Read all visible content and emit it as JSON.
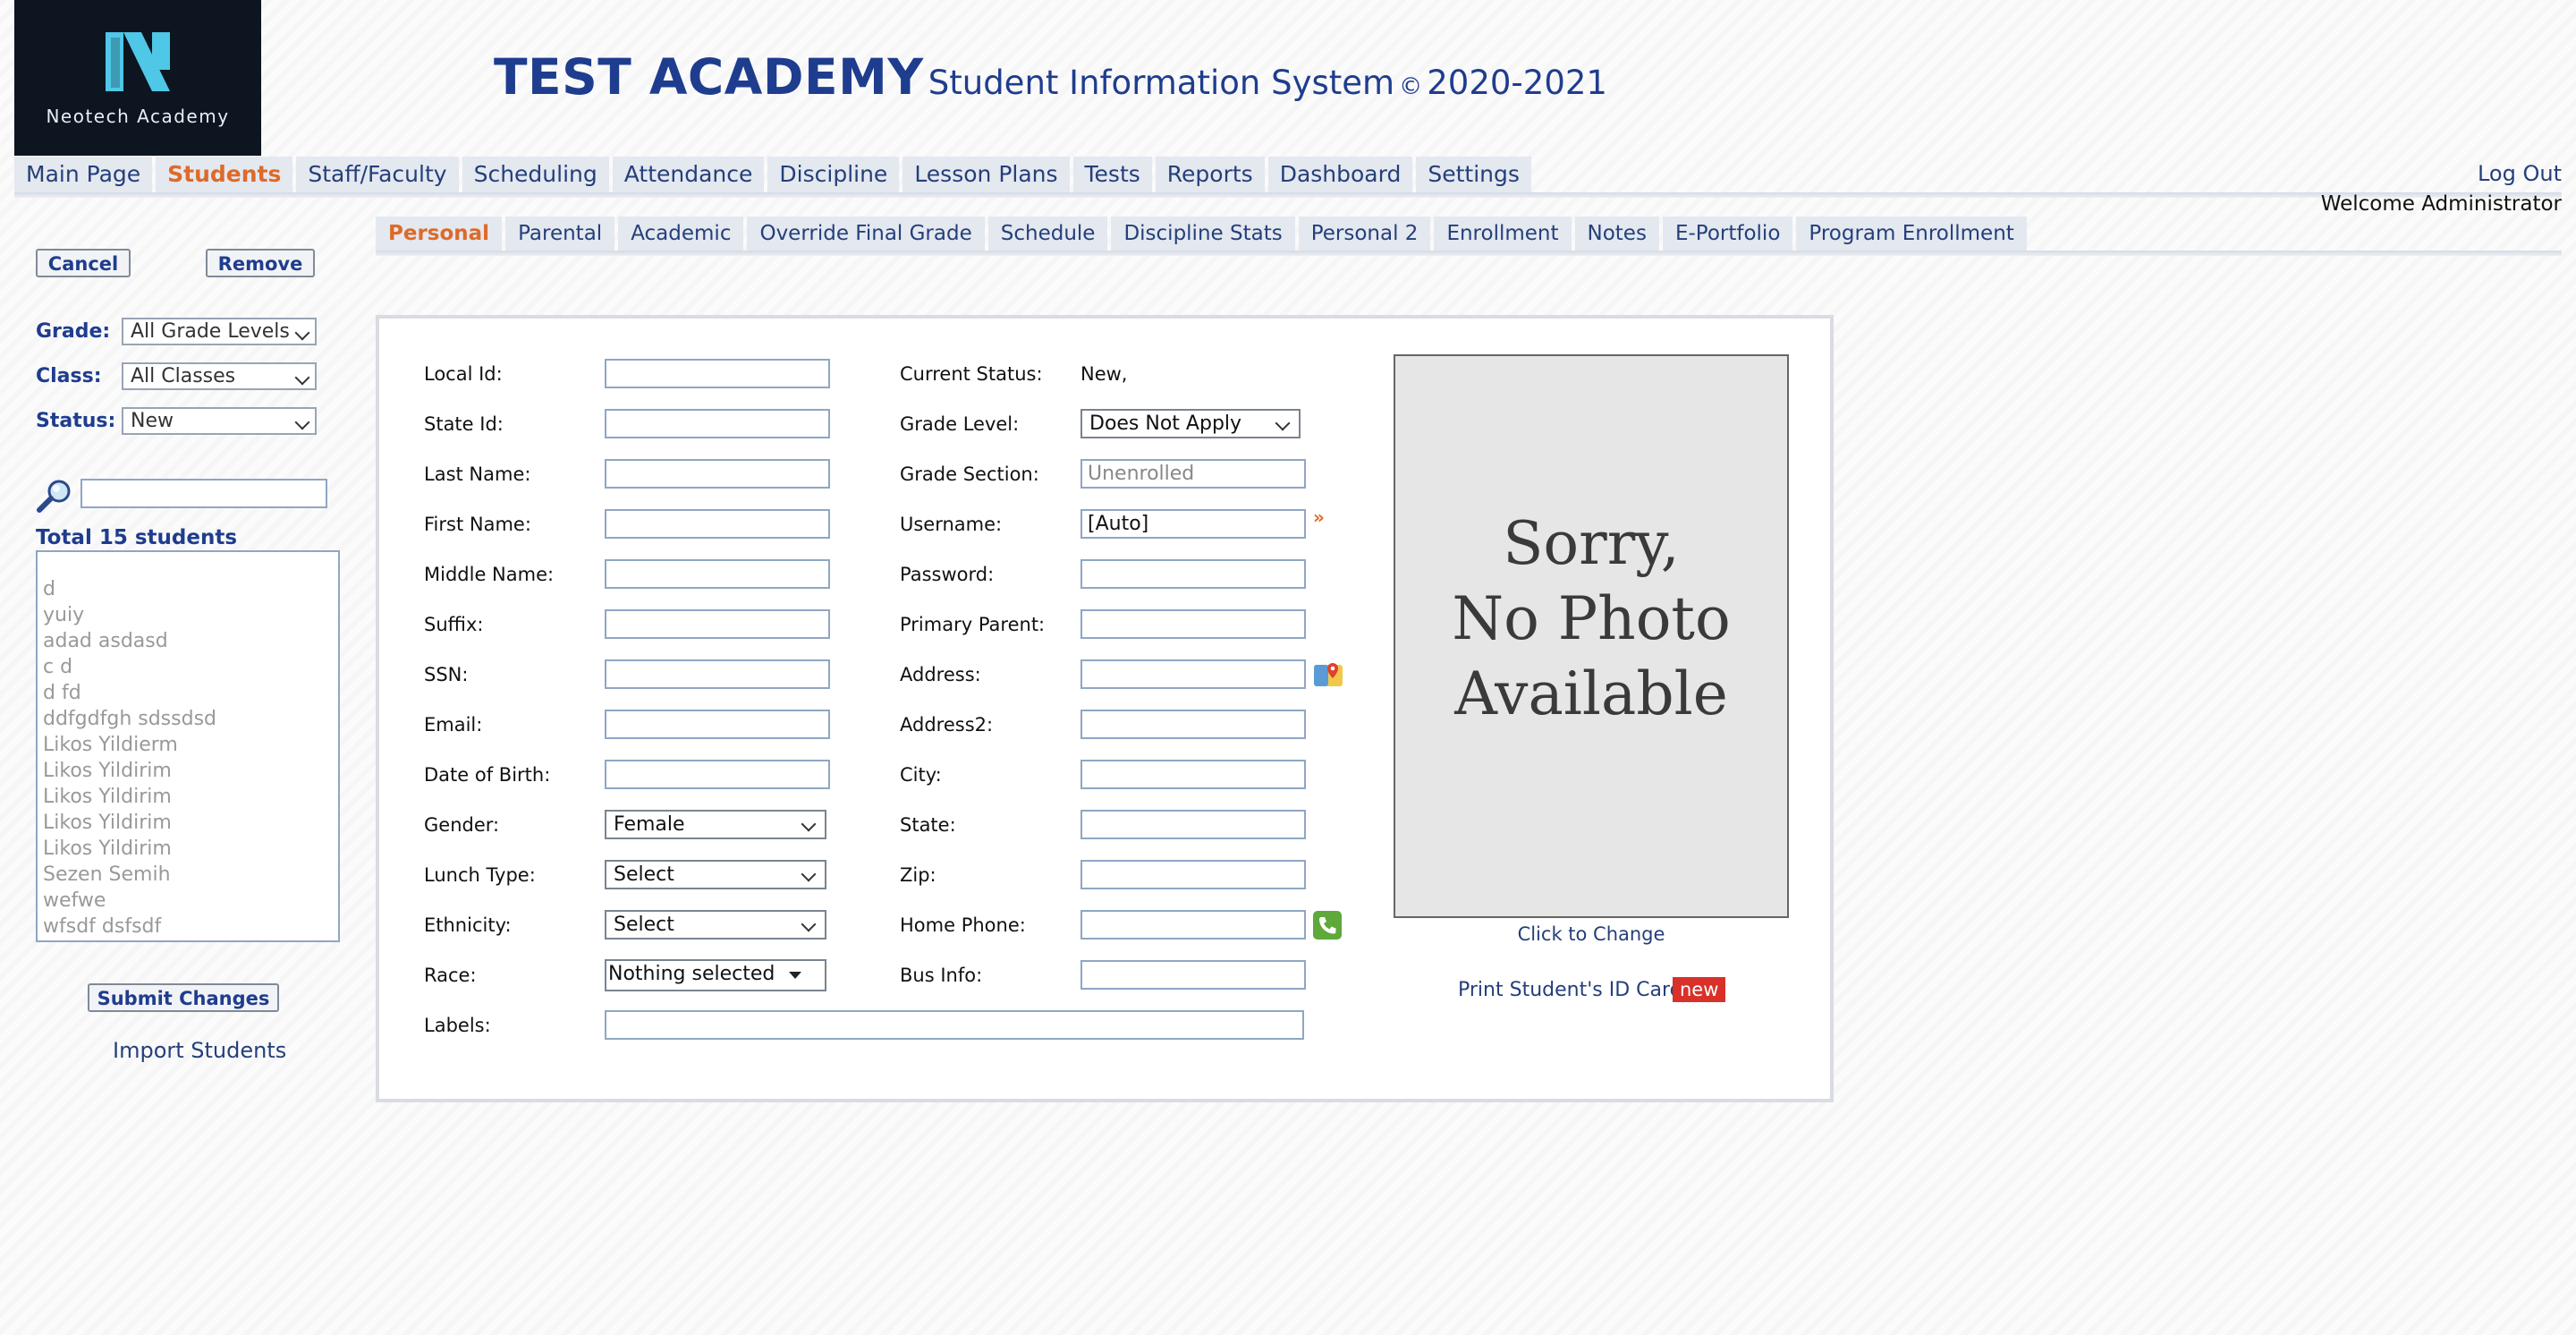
{
  "header": {
    "logo_text": "Neotech Academy",
    "title_main": "TEST ACADEMY",
    "title_sub": "Student Information System",
    "copyright": "©",
    "school_year": "2020-2021"
  },
  "main_nav": {
    "items": [
      "Main Page",
      "Students",
      "Staff/Faculty",
      "Scheduling",
      "Attendance",
      "Discipline",
      "Lesson Plans",
      "Tests",
      "Reports",
      "Dashboard",
      "Settings"
    ],
    "active": "Students",
    "logout": "Log Out",
    "welcome": "Welcome Administrator"
  },
  "tabs": {
    "items": [
      "Personal",
      "Parental",
      "Academic",
      "Override Final Grade",
      "Schedule",
      "Discipline Stats",
      "Personal 2",
      "Enrollment",
      "Notes",
      "E-Portfolio",
      "Program Enrollment"
    ],
    "active": "Personal"
  },
  "sidebar": {
    "cancel": "Cancel",
    "remove": "Remove",
    "grade_label": "Grade:",
    "grade_value": "All Grade Levels",
    "class_label": "Class:",
    "class_value": "All Classes",
    "status_label": "Status:",
    "status_value": "New",
    "search_value": "",
    "total": "Total 15 students",
    "students": [
      "",
      "d",
      "yuiy",
      "adad asdasd",
      "c d",
      "d fd",
      "ddfgdfgh sdssdsd",
      "Likos Yildierm",
      "Likos Yildirim",
      "Likos Yildirim",
      "Likos Yildirim",
      "Likos Yildirim",
      "Sezen Semih",
      "wefwe",
      "wfsdf dsfsdf"
    ],
    "submit": "Submit Changes",
    "import": "Import Students"
  },
  "form": {
    "left": [
      {
        "label": "Local Id:",
        "type": "text",
        "value": ""
      },
      {
        "label": "State Id:",
        "type": "text",
        "value": ""
      },
      {
        "label": "Last Name:",
        "type": "text",
        "value": ""
      },
      {
        "label": "First Name:",
        "type": "text",
        "value": ""
      },
      {
        "label": "Middle Name:",
        "type": "text",
        "value": ""
      },
      {
        "label": "Suffix:",
        "type": "text",
        "value": ""
      },
      {
        "label": "SSN:",
        "type": "text",
        "value": ""
      },
      {
        "label": "Email:",
        "type": "text",
        "value": ""
      },
      {
        "label": "Date of Birth:",
        "type": "text",
        "value": ""
      },
      {
        "label": "Gender:",
        "type": "select",
        "value": "Female"
      },
      {
        "label": "Lunch Type:",
        "type": "select",
        "value": "Select"
      },
      {
        "label": "Ethnicity:",
        "type": "select",
        "value": "Select"
      },
      {
        "label": "Race:",
        "type": "multiselect",
        "value": "Nothing selected"
      }
    ],
    "labels_label": "Labels:",
    "labels_value": "",
    "right": [
      {
        "label": "Current Status:",
        "type": "static",
        "value": "New,"
      },
      {
        "label": "Grade Level:",
        "type": "select",
        "value": "Does Not Apply"
      },
      {
        "label": "Grade Section:",
        "type": "text",
        "value": "",
        "placeholder": "Unenrolled"
      },
      {
        "label": "Username:",
        "type": "text",
        "value": "[Auto]"
      },
      {
        "label": "Password:",
        "type": "text",
        "value": ""
      },
      {
        "label": "Primary Parent:",
        "type": "text",
        "value": ""
      },
      {
        "label": "Address:",
        "type": "text",
        "value": ""
      },
      {
        "label": "Address2:",
        "type": "text",
        "value": ""
      },
      {
        "label": "City:",
        "type": "text",
        "value": ""
      },
      {
        "label": "State:",
        "type": "text",
        "value": ""
      },
      {
        "label": "Zip:",
        "type": "text",
        "value": ""
      },
      {
        "label": "Home Phone:",
        "type": "text",
        "value": ""
      },
      {
        "label": "Bus Info:",
        "type": "text",
        "value": ""
      }
    ],
    "icons": {
      "username": "double-chevron-right-icon",
      "address": "map-pin-icon",
      "phone": "phone-icon"
    }
  },
  "photo": {
    "line1": "Sorry,",
    "line2": "No Photo",
    "line3": "Available",
    "click_to_change": "Click to Change",
    "print_id": "Print Student's ID Card",
    "new_badge": "new"
  },
  "colors": {
    "brand_blue": "#1f3d8e",
    "active_orange": "#dd6a2a",
    "badge_red": "#d9302a",
    "logo_bg": "#0d1520",
    "logo_cyan": "#4fc7e6"
  }
}
